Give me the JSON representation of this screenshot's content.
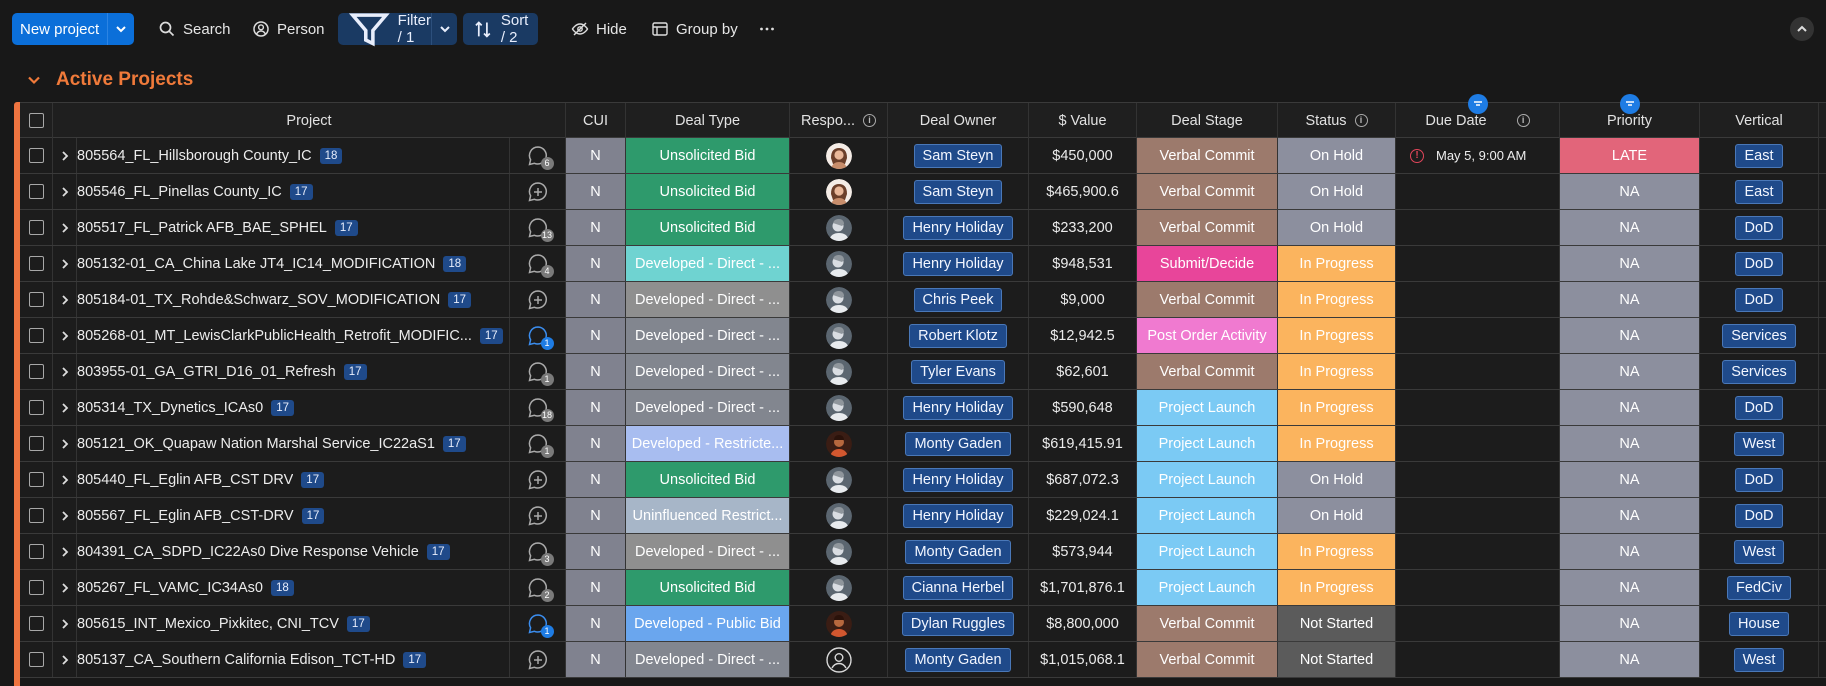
{
  "toolbar": {
    "new_project": "New project",
    "search": "Search",
    "person": "Person",
    "filter": "Filter / 1",
    "sort": "Sort / 2",
    "hide": "Hide",
    "group_by": "Group by"
  },
  "group": {
    "title": "Active Projects"
  },
  "columns": {
    "project": "Project",
    "cui": "CUI",
    "deal_type": "Deal Type",
    "responsible": "Respo...",
    "deal_owner": "Deal Owner",
    "value": "$ Value",
    "deal_stage": "Deal Stage",
    "status": "Status",
    "due_date": "Due Date",
    "priority": "Priority",
    "vertical": "Vertical"
  },
  "colors": {
    "accent": "#ee7440",
    "unsolicited": "#2e9a6c",
    "developed_direct": "#82868f",
    "developed_direct_teal": "#6fd3d1",
    "developed_direct_gray": "#8f8f8f",
    "developed_restricted": "#a8bdf0",
    "uninfluenced": "#a7b6c8",
    "developed_public": "#6aa6ee",
    "verbal_commit": "#9c7a6c",
    "submit_decide": "#e8459a",
    "post_order": "#f07ad0",
    "project_launch": "#7bcaf4",
    "on_hold": "#8c8f9e",
    "in_progress": "#fbb45e",
    "not_started": "#5b5b5b",
    "late": "#e2657a"
  },
  "rows": [
    {
      "project": "805564_FL_Hillsborough County_IC",
      "count": "18",
      "updates": "6",
      "updates_blue": false,
      "cui": "N",
      "deal_type": "Unsolicited Bid",
      "deal_type_color": "#2e9a6c",
      "avatar": "woman",
      "owner": "Sam Steyn",
      "value": "$450,000",
      "stage": "Verbal Commit",
      "stage_color": "#9c7a6c",
      "status": "On Hold",
      "status_color": "#8c8f9e",
      "due": "May 5, 9:00 AM",
      "due_warn": true,
      "priority": "LATE",
      "priority_color": "#e2657a",
      "vertical": "East"
    },
    {
      "project": "805546_FL_Pinellas County_IC",
      "count": "17",
      "updates": "",
      "updates_blue": false,
      "cui": "N",
      "deal_type": "Unsolicited Bid",
      "deal_type_color": "#2e9a6c",
      "avatar": "woman",
      "owner": "Sam Steyn",
      "value": "$465,900.6",
      "stage": "Verbal Commit",
      "stage_color": "#9c7a6c",
      "status": "On Hold",
      "status_color": "#8c8f9e",
      "due": "",
      "due_warn": false,
      "priority": "NA",
      "priority_color": "#8c8f9e",
      "vertical": "East"
    },
    {
      "project": "805517_FL_Patrick AFB_BAE_SPHEL",
      "count": "17",
      "updates": "13",
      "updates_blue": false,
      "cui": "N",
      "deal_type": "Unsolicited Bid",
      "deal_type_color": "#2e9a6c",
      "avatar": "man",
      "owner": "Henry Holiday",
      "value": "$233,200",
      "stage": "Verbal Commit",
      "stage_color": "#9c7a6c",
      "status": "On Hold",
      "status_color": "#8c8f9e",
      "due": "",
      "due_warn": false,
      "priority": "NA",
      "priority_color": "#8c8f9e",
      "vertical": "DoD"
    },
    {
      "project": "805132-01_CA_China Lake JT4_IC14_MODIFICATION",
      "count": "18",
      "updates": "4",
      "updates_blue": false,
      "cui": "N",
      "deal_type": "Developed - Direct - ...",
      "deal_type_color": "#6fd3d1",
      "avatar": "man",
      "owner": "Henry Holiday",
      "value": "$948,531",
      "stage": "Submit/Decide",
      "stage_color": "#e8459a",
      "status": "In Progress",
      "status_color": "#fbb45e",
      "due": "",
      "due_warn": false,
      "priority": "NA",
      "priority_color": "#8c8f9e",
      "vertical": "DoD"
    },
    {
      "project": "805184-01_TX_Rohde&Schwarz_SOV_MODIFICATION",
      "count": "17",
      "updates": "",
      "updates_blue": false,
      "cui": "N",
      "deal_type": "Developed - Direct - ...",
      "deal_type_color": "#8f8f8f",
      "avatar": "man",
      "owner": "Chris Peek",
      "value": "$9,000",
      "stage": "Verbal Commit",
      "stage_color": "#9c7a6c",
      "status": "In Progress",
      "status_color": "#fbb45e",
      "due": "",
      "due_warn": false,
      "priority": "NA",
      "priority_color": "#8c8f9e",
      "vertical": "DoD"
    },
    {
      "project": "805268-01_MT_LewisClarkPublicHealth_Retrofit_MODIFIC...",
      "count": "17",
      "updates": "1",
      "updates_blue": true,
      "cui": "N",
      "deal_type": "Developed - Direct - ...",
      "deal_type_color": "#82868f",
      "avatar": "man",
      "owner": "Robert Klotz",
      "value": "$12,942.5",
      "stage": "Post Order Activity",
      "stage_color": "#f07ad0",
      "status": "In Progress",
      "status_color": "#fbb45e",
      "due": "",
      "due_warn": false,
      "priority": "NA",
      "priority_color": "#8c8f9e",
      "vertical": "Services"
    },
    {
      "project": "803955-01_GA_GTRI_D16_01_Refresh",
      "count": "17",
      "updates": "1",
      "updates_blue": false,
      "cui": "N",
      "deal_type": "Developed - Direct - ...",
      "deal_type_color": "#82868f",
      "avatar": "man",
      "owner": "Tyler Evans",
      "value": "$62,601",
      "stage": "Verbal Commit",
      "stage_color": "#9c7a6c",
      "status": "In Progress",
      "status_color": "#fbb45e",
      "due": "",
      "due_warn": false,
      "priority": "NA",
      "priority_color": "#8c8f9e",
      "vertical": "Services"
    },
    {
      "project": "805314_TX_Dynetics_ICAs0",
      "count": "17",
      "updates": "18",
      "updates_blue": false,
      "cui": "N",
      "deal_type": "Developed - Direct - ...",
      "deal_type_color": "#82868f",
      "avatar": "man",
      "owner": "Henry Holiday",
      "value": "$590,648",
      "stage": "Project Launch",
      "stage_color": "#7bcaf4",
      "status": "In Progress",
      "status_color": "#fbb45e",
      "due": "",
      "due_warn": false,
      "priority": "NA",
      "priority_color": "#8c8f9e",
      "vertical": "DoD"
    },
    {
      "project": "805121_OK_Quapaw Nation Marshal Service_IC22aS1",
      "count": "17",
      "updates": "1",
      "updates_blue": false,
      "cui": "N",
      "deal_type": "Developed - Restricte...",
      "deal_type_color": "#a8bdf0",
      "avatar": "dark",
      "owner": "Monty Gaden",
      "value": "$619,415.91",
      "stage": "Project Launch",
      "stage_color": "#7bcaf4",
      "status": "In Progress",
      "status_color": "#fbb45e",
      "due": "",
      "due_warn": false,
      "priority": "NA",
      "priority_color": "#8c8f9e",
      "vertical": "West"
    },
    {
      "project": "805440_FL_Eglin AFB_CST DRV",
      "count": "17",
      "updates": "",
      "updates_blue": false,
      "cui": "N",
      "deal_type": "Unsolicited Bid",
      "deal_type_color": "#2e9a6c",
      "avatar": "man",
      "owner": "Henry Holiday",
      "value": "$687,072.3",
      "stage": "Project Launch",
      "stage_color": "#7bcaf4",
      "status": "On Hold",
      "status_color": "#8c8f9e",
      "due": "",
      "due_warn": false,
      "priority": "NA",
      "priority_color": "#8c8f9e",
      "vertical": "DoD"
    },
    {
      "project": "805567_FL_Eglin AFB_CST-DRV",
      "count": "17",
      "updates": "",
      "updates_blue": false,
      "cui": "N",
      "deal_type": "Uninfluenced Restrict...",
      "deal_type_color": "#a7b6c8",
      "avatar": "man",
      "owner": "Henry Holiday",
      "value": "$229,024.1",
      "stage": "Project Launch",
      "stage_color": "#7bcaf4",
      "status": "On Hold",
      "status_color": "#8c8f9e",
      "due": "",
      "due_warn": false,
      "priority": "NA",
      "priority_color": "#8c8f9e",
      "vertical": "DoD"
    },
    {
      "project": "804391_CA_SDPD_IC22As0 Dive Response Vehicle",
      "count": "17",
      "updates": "3",
      "updates_blue": false,
      "cui": "N",
      "deal_type": "Developed - Direct - ...",
      "deal_type_color": "#8f8f8f",
      "avatar": "man",
      "owner": "Monty Gaden",
      "value": "$573,944",
      "stage": "Project Launch",
      "stage_color": "#7bcaf4",
      "status": "In Progress",
      "status_color": "#fbb45e",
      "due": "",
      "due_warn": false,
      "priority": "NA",
      "priority_color": "#8c8f9e",
      "vertical": "West"
    },
    {
      "project": "805267_FL_VAMC_IC34As0",
      "count": "18",
      "updates": "2",
      "updates_blue": false,
      "cui": "N",
      "deal_type": "Unsolicited Bid",
      "deal_type_color": "#2e9a6c",
      "avatar": "man",
      "owner": "Cianna Herbel",
      "value": "$1,701,876.1",
      "stage": "Project Launch",
      "stage_color": "#7bcaf4",
      "status": "In Progress",
      "status_color": "#fbb45e",
      "due": "",
      "due_warn": false,
      "priority": "NA",
      "priority_color": "#8c8f9e",
      "vertical": "FedCiv"
    },
    {
      "project": "805615_INT_Mexico_Pixkitec, CNI_TCV",
      "count": "17",
      "updates": "1",
      "updates_blue": true,
      "cui": "N",
      "deal_type": "Developed - Public Bid",
      "deal_type_color": "#6aa6ee",
      "avatar": "dark",
      "owner": "Dylan Ruggles",
      "value": "$8,800,000",
      "stage": "Verbal Commit",
      "stage_color": "#9c7a6c",
      "status": "Not Started",
      "status_color": "#5b5b5b",
      "due": "",
      "due_warn": false,
      "priority": "NA",
      "priority_color": "#8c8f9e",
      "vertical": "House"
    },
    {
      "project": "805137_CA_Southern California Edison_TCT-HD",
      "count": "17",
      "updates": "",
      "updates_blue": false,
      "cui": "N",
      "deal_type": "Developed - Direct - ...",
      "deal_type_color": "#82868f",
      "avatar": "empty",
      "owner": "Monty Gaden",
      "value": "$1,015,068.1",
      "stage": "Verbal Commit",
      "stage_color": "#9c7a6c",
      "status": "Not Started",
      "status_color": "#5b5b5b",
      "due": "",
      "due_warn": false,
      "priority": "NA",
      "priority_color": "#8c8f9e",
      "vertical": "West"
    }
  ]
}
